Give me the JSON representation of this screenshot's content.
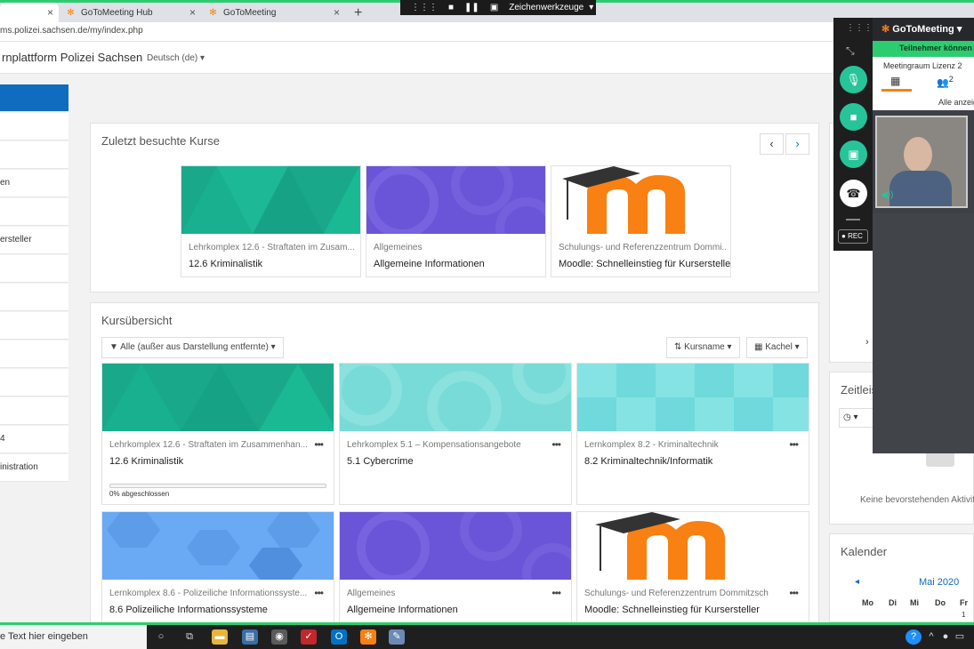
{
  "browser": {
    "tabs": [
      {
        "label": "",
        "active": true
      },
      {
        "label": "GoToMeeting Hub",
        "active": false
      },
      {
        "label": "GoToMeeting",
        "active": false
      }
    ],
    "url": "ms.polizei.sachsen.de/my/index.php",
    "new_tab_glyph": "+",
    "close_glyph": "×"
  },
  "share_toolbar": {
    "drawing_tools_label": "Zeichenwerkzeuge"
  },
  "site": {
    "title": "rnplattform Polizei Sachsen",
    "language": "Deutsch (de)"
  },
  "drawer": {
    "items": [
      {
        "label": ""
      },
      {
        "label": ""
      },
      {
        "label": ""
      },
      {
        "label": "en"
      },
      {
        "label": ""
      },
      {
        "label": "ersteller"
      },
      {
        "label": ""
      },
      {
        "label": ""
      },
      {
        "label": ""
      },
      {
        "label": ""
      },
      {
        "label": ""
      },
      {
        "label": ""
      },
      {
        "label": "4"
      },
      {
        "label": "inistration"
      }
    ]
  },
  "recent_courses": {
    "title": "Zuletzt besuchte Kurse",
    "prev_glyph": "‹",
    "next_glyph": "›",
    "cards": [
      {
        "category": "Lehrkomplex 12.6 - Straftaten im Zusam...",
        "name": "12.6 Kriminalistik",
        "pattern": "green-triangles"
      },
      {
        "category": "Allgemeines",
        "name": "Allgemeine Informationen",
        "pattern": "purple-circles"
      },
      {
        "category": "Schulungs- und Referenzzentrum Dommi...",
        "name": "Moodle: Schnelleinstieg für Kursersteller",
        "pattern": "moodle-logo"
      }
    ]
  },
  "course_overview": {
    "title": "Kursübersicht",
    "filter_label": "Alle (außer aus Darstellung entfernte)",
    "sort_label": "Kursname",
    "view_label": "Kachel",
    "cards": [
      {
        "category": "Lehrkomplex 12.6 - Straftaten im Zusammenhan...",
        "name": "12.6 Kriminalistik",
        "progress_pct": 0,
        "progress_text": "0% abgeschlossen",
        "pattern": "green-triangles"
      },
      {
        "category": "Lehrkomplex 5.1 – Kompensationsangebote",
        "name": "5.1 Cybercrime",
        "pattern": "teal-circles"
      },
      {
        "category": "Lernkomplex 8.2 - Kriminaltechnik",
        "name": "8.2 Kriminaltechnik/Informatik",
        "pattern": "teal-squares"
      },
      {
        "category": "Lernkomplex 8.6 - Polizeiliche Informationssyste...",
        "name": "8.6 Polizeiliche Informationssysteme",
        "pattern": "blue-hexagons"
      },
      {
        "category": "Allgemeines",
        "name": "Allgemeine Informationen",
        "pattern": "purple-circles"
      },
      {
        "category": "Schulungs- und Referenzzentrum Dommitzsch",
        "name": "Moodle: Schnelleinstieg für Kursersteller",
        "pattern": "moodle-logo"
      }
    ],
    "more_glyph": "•••"
  },
  "right_column": {
    "timeline_title": "Zeitleis",
    "no_activities": "Keine bevorstehenden Aktivit",
    "calendar_title": "Kalender",
    "calendar_month": "Mai 2020",
    "calendar_days": [
      "Mo",
      "Di",
      "Mi",
      "Do",
      "Fr"
    ],
    "calendar_first_day": "1"
  },
  "gotomeeting": {
    "brand": "GoToMeeting",
    "banner": "Teilnehmer können",
    "room": "Meetingraum Lizenz 2",
    "participants_count": "2",
    "show_all": "Alle anzeig",
    "rec_label": "REC"
  },
  "taskbar": {
    "search_placeholder": "e Text hier eingeben"
  },
  "colors": {
    "moodle_blue": "#0f6cbf",
    "goto_green": "#2ecc71",
    "goto_control_green": "#27c49a",
    "moodle_orange": "#f98012"
  }
}
